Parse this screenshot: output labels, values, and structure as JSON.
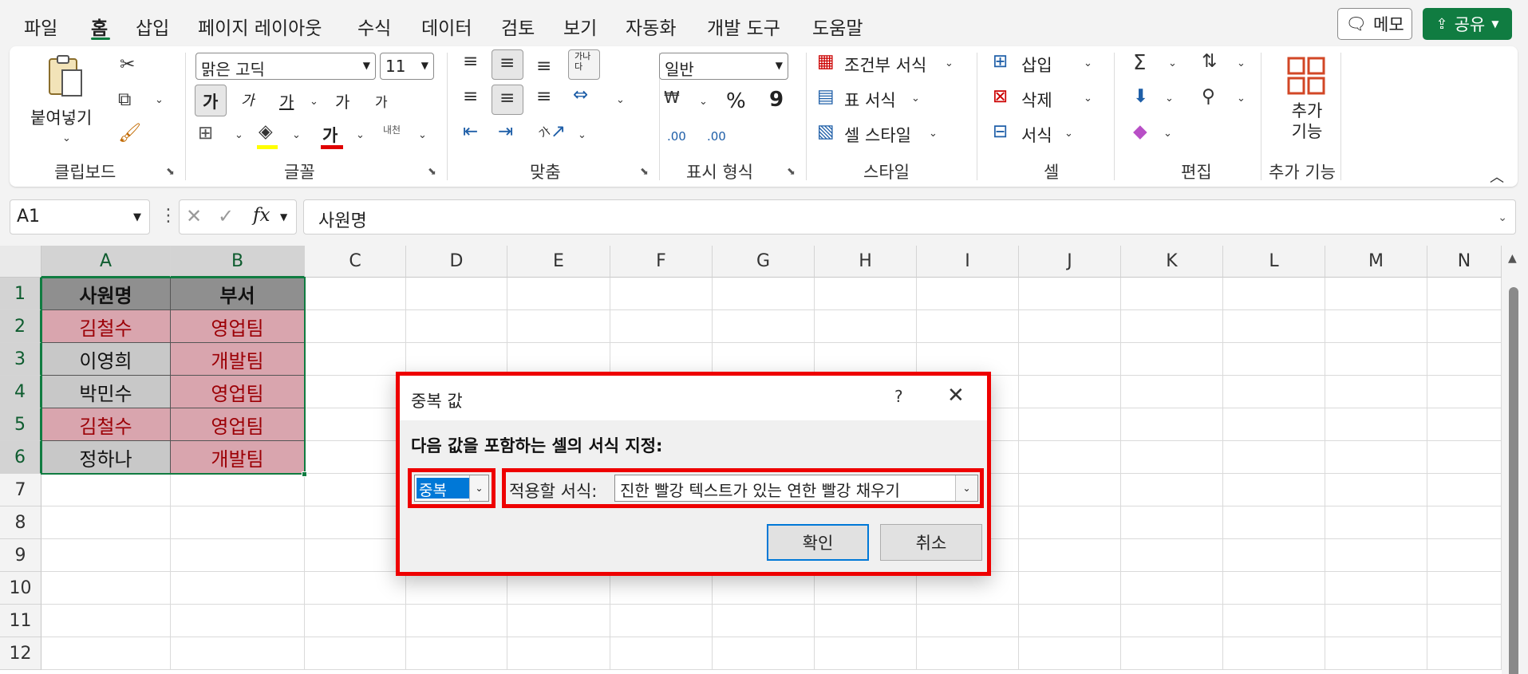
{
  "menu": {
    "tabs": [
      "파일",
      "홈",
      "삽입",
      "페이지 레이아웃",
      "수식",
      "데이터",
      "검토",
      "보기",
      "자동화",
      "개발 도구",
      "도움말"
    ],
    "active_tab": "홈",
    "memo_label": "메모",
    "share_label": "공유"
  },
  "ribbon": {
    "clipboard": {
      "paste_label": "붙여넣기",
      "group": "클립보드"
    },
    "font": {
      "name": "맑은 고딕",
      "size": "11",
      "bold": "가",
      "italic": "가",
      "underline": "가",
      "grow": "가",
      "shrink": "가",
      "color_glyph": "가",
      "phonetic": "내천",
      "group": "글꼴"
    },
    "alignment": {
      "wrap_glyph": "가나다",
      "orient_glyph": "가",
      "group": "맞춤"
    },
    "number": {
      "format": "일반",
      "percent": "%",
      "comma": "9",
      "inc_decimal": ".00",
      "dec_decimal": ".00",
      "group": "표시 형식"
    },
    "styles": {
      "conditional": "조건부 서식",
      "table": "표 서식",
      "cell_style": "셀 스타일",
      "group": "스타일"
    },
    "cells": {
      "insert": "삽입",
      "delete": "삭제",
      "format": "서식",
      "group": "셀"
    },
    "editing": {
      "group": "편집"
    },
    "addins": {
      "label": "추가\n기능",
      "group": "추가 기능"
    }
  },
  "formula_bar": {
    "name_box": "A1",
    "formula": "사원명",
    "fx": "fx"
  },
  "sheet": {
    "columns": [
      "A",
      "B",
      "C",
      "D",
      "E",
      "F",
      "G",
      "H",
      "I",
      "J",
      "K",
      "L",
      "M",
      "N"
    ],
    "rows": [
      "1",
      "2",
      "3",
      "4",
      "5",
      "6",
      "7",
      "8",
      "9",
      "10",
      "11",
      "12"
    ],
    "cells": [
      {
        "a": "사원명",
        "b": "부서",
        "a_style": "hdr",
        "b_style": "hdr"
      },
      {
        "a": "김철수",
        "b": "영업팀",
        "a_style": "dup",
        "b_style": "dup"
      },
      {
        "a": "이영희",
        "b": "개발팀",
        "a_style": "plain",
        "b_style": "dup"
      },
      {
        "a": "박민수",
        "b": "영업팀",
        "a_style": "plain",
        "b_style": "dup"
      },
      {
        "a": "김철수",
        "b": "영업팀",
        "a_style": "dup",
        "b_style": "dup"
      },
      {
        "a": "정하나",
        "b": "개발팀",
        "a_style": "plain",
        "b_style": "dup"
      }
    ],
    "highlight_colors": {
      "duplicate_fill": "#d9a5ae",
      "duplicate_text": "#9c0006",
      "selection": "#107c41"
    }
  },
  "dialog": {
    "title": "중복 값",
    "help": "?",
    "prompt": "다음 값을 포함하는 셀의 서식 지정:",
    "mode_value": "중복",
    "format_label": "적용할 서식:",
    "format_value": "진한 빨강 텍스트가 있는 연한 빨강 채우기",
    "ok_label": "확인",
    "cancel_label": "취소",
    "annotation_color": "#ee0000"
  }
}
